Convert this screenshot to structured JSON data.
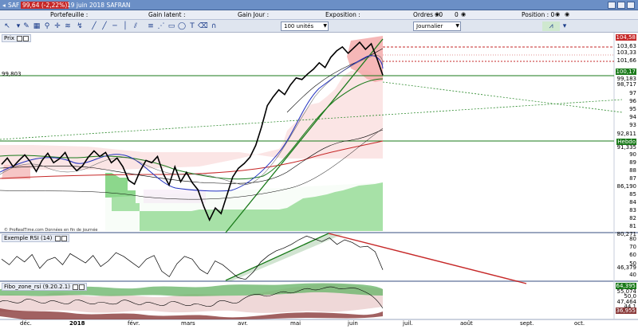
{
  "window": {
    "title_symbol": "SAF",
    "price_badge": "99,64 (-2,22%)",
    "date_name": "19 juin 2018 SAFRAN"
  },
  "infobar": {
    "portefeuille": "Portefeuille :",
    "gain_latent": "Gain latent :",
    "gain_jour": "Gain Jour :",
    "exposition": "Exposition :",
    "ordres": "Ordres : 0",
    "ordres_val": "0",
    "position": "Position : 0"
  },
  "toolbar": {
    "quantity": "100 unités",
    "period": "Journalier"
  },
  "panels": {
    "price": {
      "label": "Prix",
      "hline_label": "99,803",
      "watermark": "© ProRealTime.com Données en fin de journée"
    },
    "rsi": {
      "label": "Exemple RSI (14)"
    },
    "fibo": {
      "label": "Fibo_zone_rsi (9.20.2.1)"
    }
  },
  "colors": {
    "price": "#000000",
    "green": "#1a7a1a",
    "red": "#c62828",
    "blue": "#1f2fc0",
    "cloud_red": "#f8c8c8",
    "cloud_green": "#7fd37f"
  },
  "chart_data": [
    {
      "type": "line",
      "title": "SAFRAN",
      "x_ticks": [
        "déc.",
        "2018",
        "févr.",
        "mars",
        "avr.",
        "mai",
        "juin",
        "juil.",
        "août",
        "sept.",
        "oct."
      ],
      "y_ticks": [
        "104,58",
        "103,63",
        "103,33",
        "101,66",
        "100,17",
        "99,183",
        "98,717",
        "97",
        "96",
        "95",
        "94",
        "93",
        "92,811",
        "Hebdo",
        "91,335",
        "90",
        "89",
        "88",
        "87",
        "86,190",
        "85",
        "84",
        "83",
        "82",
        "81",
        "80,271"
      ],
      "ylim": [
        80,
        105
      ],
      "horizontal_line": 99.803,
      "series": [
        {
          "values": [
            88.4,
            89.2,
            88.1,
            88.9,
            89.6,
            88.7,
            87.5,
            88.9,
            89.8,
            88.6,
            89.1,
            89.9,
            88.4,
            87.6,
            88.2,
            89.3,
            90.1,
            89.4,
            89.9,
            88.6,
            89.2,
            88.1,
            86.4,
            85.9,
            87.6,
            88.9,
            88.6,
            89.4,
            87.2,
            85.8,
            88.1,
            86.2,
            87.4,
            86.1,
            85.2,
            83.1,
            81.4,
            82.9,
            82.2,
            84.5,
            86.8,
            87.9,
            88.5,
            89.3,
            90.8,
            93.1,
            95.8,
            96.9,
            97.8,
            97.2,
            98.4,
            99.3,
            99.1,
            99.8,
            100.4,
            101.2,
            100.6,
            101.9,
            102.7,
            103.2,
            102.4,
            103.1,
            103.8,
            102.9,
            103.6,
            101.7,
            99.64
          ]
        }
      ]
    },
    {
      "type": "line",
      "title": "Exemple RSI (14)",
      "y_ticks": [
        "80",
        "70",
        "60",
        "50",
        "46,379",
        "40"
      ],
      "ylim": [
        35,
        85
      ],
      "series": [
        {
          "values": [
            58,
            52,
            61,
            55,
            63,
            48,
            57,
            60,
            52,
            64,
            59,
            54,
            62,
            50,
            56,
            65,
            61,
            55,
            49,
            58,
            62,
            45,
            39,
            53,
            61,
            58,
            47,
            42,
            56,
            52,
            45,
            38,
            36,
            44,
            55,
            62,
            67,
            70,
            74,
            79,
            83,
            80,
            77,
            81,
            74,
            79,
            76,
            71,
            72,
            66,
            46.379
          ]
        }
      ]
    },
    {
      "type": "area",
      "title": "Fibo_zone_rsi (9.20.2.1)",
      "y_ticks": [
        "64,395",
        "55,074",
        "50,0",
        "47,464",
        "44,1",
        "36,955"
      ],
      "ylim": [
        30,
        70
      ]
    }
  ]
}
